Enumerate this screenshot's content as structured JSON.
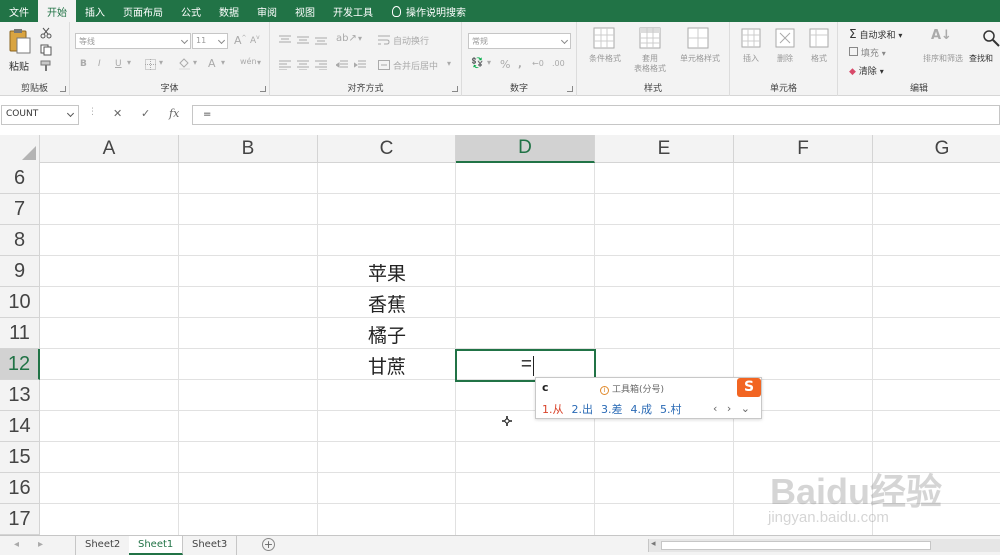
{
  "ribbon": {
    "tabs": [
      "文件",
      "开始",
      "插入",
      "页面布局",
      "公式",
      "数据",
      "审阅",
      "视图",
      "开发工具"
    ],
    "active_tab": "开始",
    "search_label": "操作说明搜索",
    "groups": {
      "clipboard": {
        "label": "剪贴板",
        "paste": "粘贴"
      },
      "font": {
        "label": "字体",
        "font_name": "等线",
        "font_size": "11",
        "bold": "B",
        "italic": "I",
        "underline": "U",
        "font_color": "A"
      },
      "alignment": {
        "label": "对齐方式",
        "wrap": "自动换行",
        "merge": "合并后居中"
      },
      "number": {
        "label": "数字",
        "format": "常规",
        "percent": "%"
      },
      "styles": {
        "label": "样式",
        "conditional": "条件格式",
        "table_1": "套用",
        "table_2": "表格格式",
        "cell_style": "单元格样式"
      },
      "cells": {
        "label": "单元格",
        "insert": "插入",
        "delete": "删除",
        "format": "格式"
      },
      "editing": {
        "label": "编辑",
        "autosum": "自动求和",
        "fill": "填充",
        "clear": "清除",
        "sort": "排序和筛选",
        "find": "查找和"
      }
    }
  },
  "formula_bar": {
    "name_box": "COUNT",
    "cancel": "✕",
    "enter": "✓",
    "fx": "fx",
    "formula": "="
  },
  "grid": {
    "columns": [
      "A",
      "B",
      "C",
      "D",
      "E",
      "F",
      "G"
    ],
    "selected_column": "D",
    "rows": [
      "6",
      "7",
      "8",
      "9",
      "10",
      "11",
      "12",
      "13",
      "14",
      "15",
      "16",
      "17"
    ],
    "selected_row": "12",
    "cells": [
      {
        "ref": "C9",
        "value": "苹果"
      },
      {
        "ref": "C10",
        "value": "香蕉"
      },
      {
        "ref": "C11",
        "value": "橘子"
      },
      {
        "ref": "C12",
        "value": "甘蔗"
      }
    ],
    "active_cell_value": "="
  },
  "ime": {
    "input": "c",
    "tip": "工具箱(分号)",
    "logo": "S",
    "candidates": [
      "1.从",
      "2.出",
      "3.差",
      "4.成",
      "5.村"
    ],
    "nav": "‹ › ⌄"
  },
  "sheets": {
    "tabs": [
      "Sheet2",
      "Sheet1",
      "Sheet3"
    ],
    "active": "Sheet1",
    "add": "+"
  },
  "watermark": {
    "brand": "Baidu经验",
    "url": "jingyan.baidu.com"
  }
}
